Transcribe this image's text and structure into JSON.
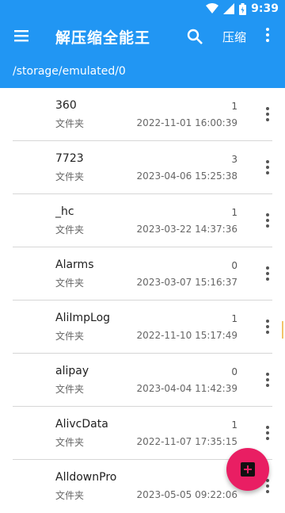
{
  "status_bar": {
    "time": "9:39",
    "icons": [
      "wifi-icon",
      "signal-icon",
      "battery-icon"
    ]
  },
  "toolbar": {
    "title": "解压缩全能王",
    "compress_label": "压缩",
    "icons": [
      "menu-icon",
      "search-icon",
      "more-vert-icon"
    ]
  },
  "path": "/storage/emulated/0",
  "colors": {
    "primary": "#2196F3",
    "fab": "#e91e63"
  },
  "files": [
    {
      "name": "360",
      "type": "文件夹",
      "count": "1",
      "date": "2022-11-01 16:00:39"
    },
    {
      "name": "7723",
      "type": "文件夹",
      "count": "3",
      "date": "2023-04-06 15:25:38"
    },
    {
      "name": "_hc",
      "type": "文件夹",
      "count": "1",
      "date": "2023-03-22 14:37:36"
    },
    {
      "name": "Alarms",
      "type": "文件夹",
      "count": "0",
      "date": "2023-03-07 15:16:37"
    },
    {
      "name": "AliImpLog",
      "type": "文件夹",
      "count": "1",
      "date": "2022-11-10 15:17:49"
    },
    {
      "name": "alipay",
      "type": "文件夹",
      "count": "0",
      "date": "2023-04-04 11:42:39"
    },
    {
      "name": "AlivcData",
      "type": "文件夹",
      "count": "1",
      "date": "2022-11-07 17:35:15"
    },
    {
      "name": "AlldownPro",
      "type": "文件夹",
      "count": "",
      "date": "2023-05-05 09:22:06"
    }
  ],
  "fab_icon": "add-box-icon"
}
